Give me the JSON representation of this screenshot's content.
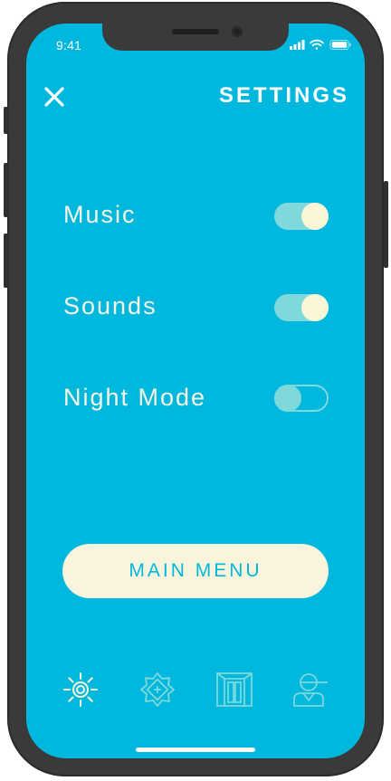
{
  "status_bar": {
    "time": "9:41"
  },
  "header": {
    "title": "SETTINGS",
    "close_icon": "close-icon"
  },
  "settings": [
    {
      "label": "Music",
      "enabled": true
    },
    {
      "label": "Sounds",
      "enabled": true
    },
    {
      "label": "Night Mode",
      "enabled": false
    }
  ],
  "main_button": {
    "label": "MAIN MENU"
  },
  "tabs": [
    {
      "icon": "sun-icon",
      "active": true
    },
    {
      "icon": "flower-icon",
      "active": false
    },
    {
      "icon": "door-icon",
      "active": false
    },
    {
      "icon": "person-icon",
      "active": false
    }
  ],
  "colors": {
    "background": "#00b8de",
    "text": "#f7f4e3",
    "toggle_track": "#7fd8db",
    "toggle_knob": "#fbf5d8",
    "button_bg": "#fbf4dc",
    "inactive_icon": "#7fd8db"
  }
}
